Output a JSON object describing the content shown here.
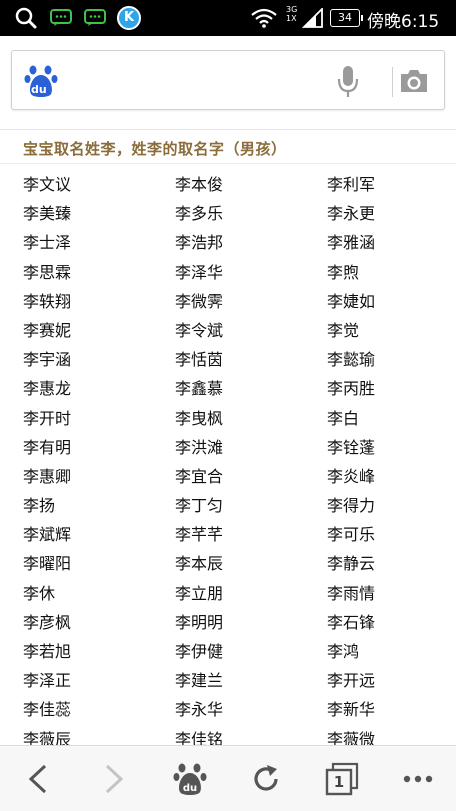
{
  "status_bar": {
    "network_type": "3G\n1X",
    "battery_level": "34",
    "carrier_time": "傍晚6:15",
    "app_badge_letter": "K"
  },
  "search": {
    "logo_text": "du",
    "value": "",
    "placeholder": ""
  },
  "page": {
    "title": "宝宝取名姓李，姓李的取名字（男孩）",
    "title_color": "#8a6d3b",
    "names": [
      [
        "李文议",
        "李本俊",
        "李利军"
      ],
      [
        "李美臻",
        "李多乐",
        "李永更"
      ],
      [
        "李士泽",
        "李浩邦",
        "李雅涵"
      ],
      [
        "李思霖",
        "李泽华",
        "李煦"
      ],
      [
        "李轶翔",
        "李微霁",
        "李婕如"
      ],
      [
        "李赛妮",
        "李令斌",
        "李觉"
      ],
      [
        "李宇涵",
        "李恬茵",
        "李懿瑜"
      ],
      [
        "李惠龙",
        "李鑫慕",
        "李丙胜"
      ],
      [
        "李开时",
        "李曳枫",
        "李白"
      ],
      [
        "李有明",
        "李洪滩",
        "李铨蓬"
      ],
      [
        "李惠卿",
        "李宜合",
        "李炎峰"
      ],
      [
        "李扬",
        "李丁匀",
        "李得力"
      ],
      [
        "李斌辉",
        "李芊芊",
        "李可乐"
      ],
      [
        "李曜阳",
        "李本辰",
        "李静云"
      ],
      [
        "李休",
        "李立朋",
        "李雨情"
      ],
      [
        "李彦枫",
        "李明明",
        "李石锋"
      ],
      [
        "李若旭",
        "李伊健",
        "李鸿"
      ],
      [
        "李泽正",
        "李建兰",
        "李开远"
      ],
      [
        "李佳蕊",
        "李永华",
        "李新华"
      ],
      [
        "李薇辰",
        "李佳铭",
        "李薇微"
      ]
    ]
  },
  "toolbar": {
    "tab_count": "1",
    "icons": [
      "back-arrow-icon",
      "forward-arrow-icon",
      "baidu-paw-icon",
      "refresh-icon",
      "tabs-icon",
      "more-dots-icon"
    ]
  },
  "colors": {
    "status_bar_bg": "#000000",
    "toolbar_bg": "#f7f7f7",
    "icon_gray": "#555555",
    "baidu_blue": "#2a61d6"
  }
}
